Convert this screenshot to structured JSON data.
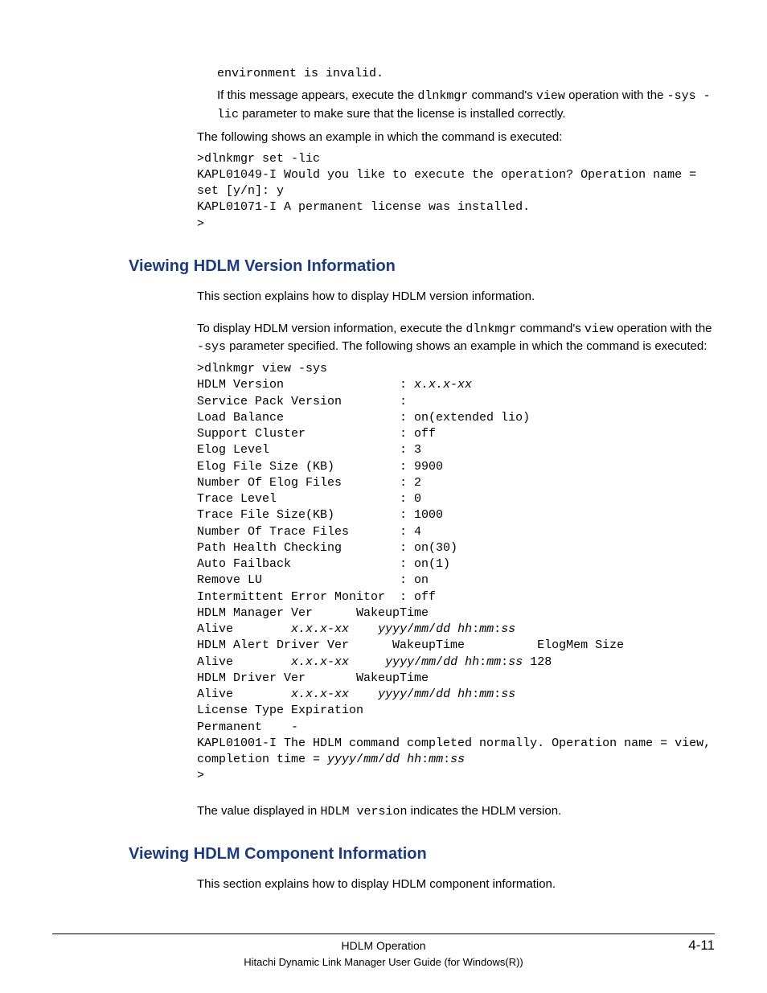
{
  "intro": {
    "env_invalid": "environment is invalid.",
    "msg_p_a": "If this message appears, execute the ",
    "cmd1": "dlnkmgr",
    "msg_p_b": " command's ",
    "cmd2": "view",
    "msg_p_c": " operation with the ",
    "cmd3": "-sys -lic",
    "msg_p_d": " parameter to make sure that the license is installed correctly.",
    "following": "The following shows an example in which the command is executed:",
    "example": ">dlnkmgr set -lic\nKAPL01049-I Would you like to execute the operation? Operation name = set [y/n]: y\nKAPL01071-I A permanent license was installed.\n>"
  },
  "sec1": {
    "heading": "Viewing HDLM Version Information",
    "explain": "This section explains how to display HDLM version information.",
    "p2a": "To display HDLM version information, execute the ",
    "cmd1": "dlnkmgr",
    "p2b": " command's ",
    "cmd2": "view",
    "p2c": " operation with the ",
    "cmd3": "-sys",
    "p2d": " parameter specified. The following shows an example in which the command is executed:",
    "ex_line1": ">dlnkmgr view -sys",
    "ex_line2a": "HDLM Version                : ",
    "ex_line2b": "x.x.x-xx",
    "ex_line3": "Service Pack Version        : ",
    "ex_line4": "Load Balance                : on(extended lio)",
    "ex_line5": "Support Cluster             : off",
    "ex_line6": "Elog Level                  : 3",
    "ex_line7": "Elog File Size (KB)         : 9900",
    "ex_line8": "Number Of Elog Files        : 2",
    "ex_line9": "Trace Level                 : 0",
    "ex_line10": "Trace File Size(KB)         : 1000",
    "ex_line11": "Number Of Trace Files       : 4",
    "ex_line12": "Path Health Checking        : on(30)",
    "ex_line13": "Auto Failback               : on(1)",
    "ex_line14": "Remove LU                   : on",
    "ex_line15": "Intermittent Error Monitor  : off",
    "ex_line16": "HDLM Manager Ver      WakeupTime",
    "ex_line17a": "Alive        ",
    "ex_line17b": "x.x.x-xx",
    "ex_line17c": "    ",
    "ex_line17d": "yyyy",
    "ex_line17e": "/",
    "ex_line17f": "mm",
    "ex_line17g": "/",
    "ex_line17h": "dd hh",
    "ex_line17i": ":",
    "ex_line17j": "mm",
    "ex_line17k": ":",
    "ex_line17l": "ss",
    "ex_line18": "HDLM Alert Driver Ver      WakeupTime          ElogMem Size",
    "ex_line19a": "Alive        ",
    "ex_line19b": "x.x.x-xx",
    "ex_line19c": "     ",
    "ex_line19d": "yyyy",
    "ex_line19e": "/",
    "ex_line19f": "mm",
    "ex_line19g": "/",
    "ex_line19h": "dd hh",
    "ex_line19i": ":",
    "ex_line19j": "mm",
    "ex_line19k": ":",
    "ex_line19l": "ss",
    "ex_line19m": " 128",
    "ex_line20": "HDLM Driver Ver       WakeupTime",
    "ex_line21a": "Alive        ",
    "ex_line21b": "x.x.x-xx",
    "ex_line21c": "    ",
    "ex_line21d": "yyyy",
    "ex_line21e": "/",
    "ex_line21f": "mm",
    "ex_line21g": "/",
    "ex_line21h": "dd hh",
    "ex_line21i": ":",
    "ex_line21j": "mm",
    "ex_line21k": ":",
    "ex_line21l": "ss",
    "ex_line22": "License Type Expiration",
    "ex_line23": "Permanent    -",
    "ex_line24a": "KAPL01001-I The HDLM command completed normally. Operation name = view, completion time = ",
    "ex_line24b": "yyyy",
    "ex_line24c": "/",
    "ex_line24d": "mm",
    "ex_line24e": "/",
    "ex_line24f": "dd hh",
    "ex_line24g": ":",
    "ex_line24h": "mm",
    "ex_line24i": ":",
    "ex_line24j": "ss",
    "ex_line25": ">",
    "value_p_a": "The value displayed in ",
    "value_cmd": "HDLM version",
    "value_p_b": " indicates the HDLM version."
  },
  "sec2": {
    "heading": "Viewing HDLM Component Information",
    "explain": "This section explains how to display HDLM component information."
  },
  "footer": {
    "section": "HDLM Operation",
    "pagenum": "4-11",
    "book": "Hitachi Dynamic Link Manager User Guide (for Windows(R))"
  }
}
